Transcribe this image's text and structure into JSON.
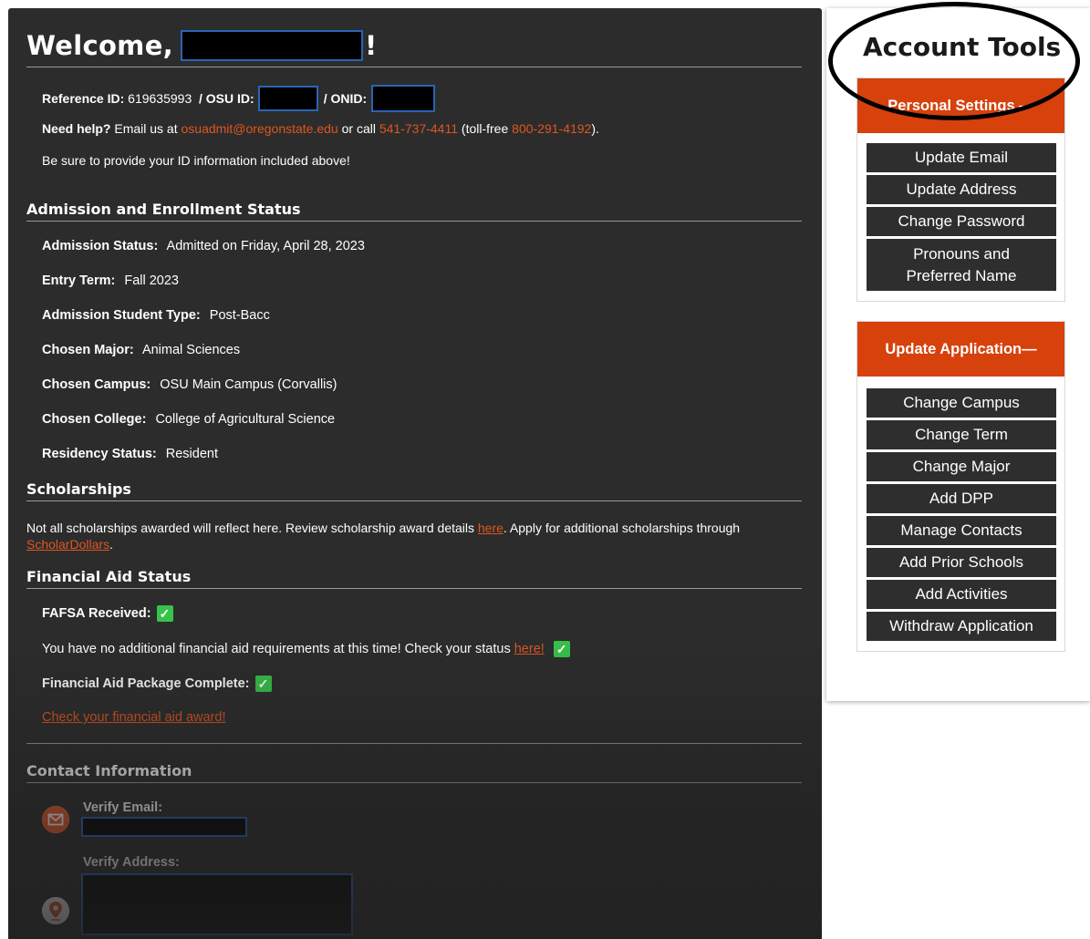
{
  "welcome": {
    "text": "Welcome,",
    "exclaim": "!"
  },
  "ids": {
    "ref_label": "Reference ID:",
    "ref_value": "619635993",
    "osu_label": "/ OSU ID:",
    "onid_label": "/ ONID:"
  },
  "help": {
    "lead": "Need help?",
    "text1": "Email us at",
    "email": "osuadmit@oregonstate.edu",
    "text2": "or call",
    "phone": "541-737-4411",
    "text3": "(toll-free",
    "tollfree": "800-291-4192",
    "text4": ")."
  },
  "reminder": "Be sure to provide your ID information included above!",
  "admission": {
    "title": "Admission and Enrollment Status",
    "fields": [
      {
        "label": "Admission Status:",
        "value": "Admitted on Friday, April 28, 2023"
      },
      {
        "label": "Entry Term:",
        "value": "Fall 2023"
      },
      {
        "label": "Admission Student Type:",
        "value": "Post-Bacc"
      },
      {
        "label": "Chosen Major:",
        "value": "Animal Sciences"
      },
      {
        "label": "Chosen Campus:",
        "value": "OSU Main Campus (Corvallis)"
      },
      {
        "label": "Chosen College:",
        "value": "College of Agricultural Science"
      },
      {
        "label": "Residency Status:",
        "value": "Resident"
      }
    ]
  },
  "scholarships": {
    "title": "Scholarships",
    "text1": "Not all scholarships awarded will reflect here. Review scholarship award details",
    "link1": "here",
    "text2": ". Apply for additional scholarships through",
    "link2": "ScholarDollars",
    "text3": "."
  },
  "financial": {
    "title": "Financial Aid Status",
    "fafsa_label": "FAFSA Received:",
    "requirements_text": "You have no additional financial aid requirements at this time! Check your status",
    "requirements_link": "here!",
    "package_label": "Financial Aid Package Complete:",
    "award_link": "Check your financial aid award!"
  },
  "contact": {
    "title": "Contact Information",
    "email_label": "Verify Email:",
    "address_label": "Verify Address:"
  },
  "sidebar": {
    "title": "Account Tools",
    "personal": {
      "header": "Personal Settings —",
      "items": [
        "Update Email",
        "Update Address",
        "Change Password",
        "Pronouns and Preferred Name"
      ]
    },
    "application": {
      "header": "Update Application—",
      "items": [
        "Change Campus",
        "Change Term",
        "Change Major",
        "Add DPP",
        "Manage Contacts",
        "Add Prior Schools",
        "Add Activities",
        "Withdraw Application"
      ]
    }
  },
  "colors": {
    "accent": "#d6410c",
    "link": "#e0551f",
    "check": "#37c24a",
    "panel": "#2c2c2c"
  },
  "icons": {
    "email": "envelope-icon",
    "address": "map-pin-icon",
    "check": "checkmark-icon"
  }
}
